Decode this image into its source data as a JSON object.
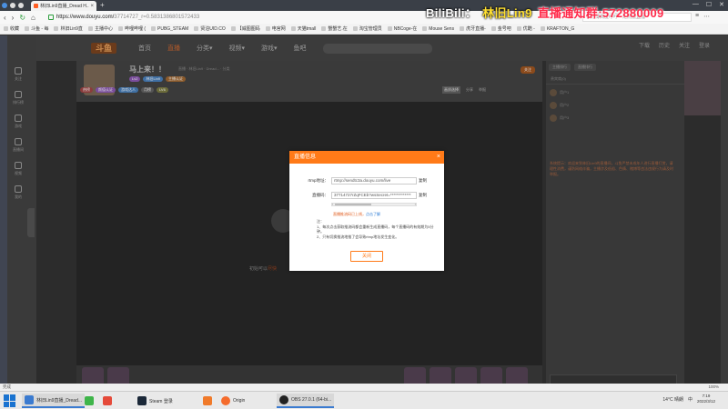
{
  "browser": {
    "tab_title": "林旧Lin9直播_Dread H...",
    "new_tab": "+",
    "url_host": "https://www.douyu.com/",
    "url_path": "37714727_r=0.5831386801572433",
    "search_placeholder": "被苏博高度呼吁一定照搬直播",
    "window_controls": [
      "—",
      "☐",
      "✕"
    ]
  },
  "banner": {
    "part1": "BiliBili：",
    "part2": "林旧Lin9",
    "part3": "直播通知群:572880009"
  },
  "bookmarks": [
    "收藏",
    "斗鱼 - 每",
    "林旧Lin9直",
    "主播中心",
    "哔哩哔哩 (",
    "PUBG_STEAM",
    "贤泊UID.CO",
    "【威图图码",
    "电官网",
    "天猫tmall",
    "蟹蟹艺.在",
    "淘宝管理员",
    "NBCoge-在",
    "Mouse Sens",
    "虎牙直播-",
    "金号吧",
    "优酷 -",
    "KRAFTON_G"
  ],
  "page": {
    "leftnav": [
      "关注",
      "排行榜",
      "游戏",
      "直播间",
      "视频",
      "我的"
    ],
    "topnav": [
      "首页",
      "直播",
      "分类▾",
      "视频▾",
      "游戏▾",
      "鱼吧"
    ],
    "logo": "斗鱼",
    "topright": [
      "下载",
      "历史",
      "关注",
      "登录"
    ],
    "room_title": "马上来！！",
    "room_sub": "直播 · 林旧Lin9 · Dread... · 分类",
    "tags_row1": [
      "Lv2",
      "林旧Lin9",
      "主播认证"
    ],
    "tags_row2": [
      "热榜",
      "颜值认证",
      "游戏达人",
      "月榜",
      "LV6"
    ],
    "follow_label": "关注",
    "room_tools": [
      "画质选择",
      "分享",
      "举报"
    ],
    "player_msg": "初始可以",
    "player_msg_hl": "尽快",
    "right_tabs": [
      "主播排行",
      "直播排行"
    ],
    "right_row": "贵宾席(0)",
    "right_items": [
      "用户1",
      "用户2",
      "用户3"
    ],
    "right_notice": "系统提示：欢迎来到林旧Lin9的直播间，斗鱼严禁未成年人进行直播打赏，请理性消费，谨防网络诈骗，主播涉及低俗、色情、赌博等违法违规行为请及时举报。"
  },
  "modal": {
    "title": "直播信息",
    "close": "×",
    "rtmp_label": "rtmp地址：",
    "rtmp_value": "rtmp://sendtc3a.douyu.com/live",
    "key_label": "直播码：",
    "key_value": "37714727rZqFCEb?wsSecret=*************",
    "copy_label": "复制",
    "warning": "直播推流码已上线，",
    "warning_link": "点击了解",
    "notes_title": "注：",
    "note1": "1、每次点击获取推流码都会重新生成直播码，每个直播码的有效期为5分钟。",
    "note2": "2、只有切换推流地推了会导致rtmp地址发生变化。",
    "close_button": "关闭"
  },
  "statusbar": {
    "left": "完成",
    "right": "100%"
  },
  "taskbar": {
    "items": [
      "林旧Lin9直播_Dread...",
      "",
      "",
      "Steam 登录",
      "",
      "Origin",
      "OBS 27.0.1 (64-bi..."
    ],
    "weather": "14°C 晴朗",
    "ime": "中",
    "time": "7:19",
    "date": "2022/3/12"
  },
  "colors": {
    "accent": "#ff7a18",
    "banner_yellow": "#ffe033",
    "banner_red": "#ff2a4a"
  }
}
